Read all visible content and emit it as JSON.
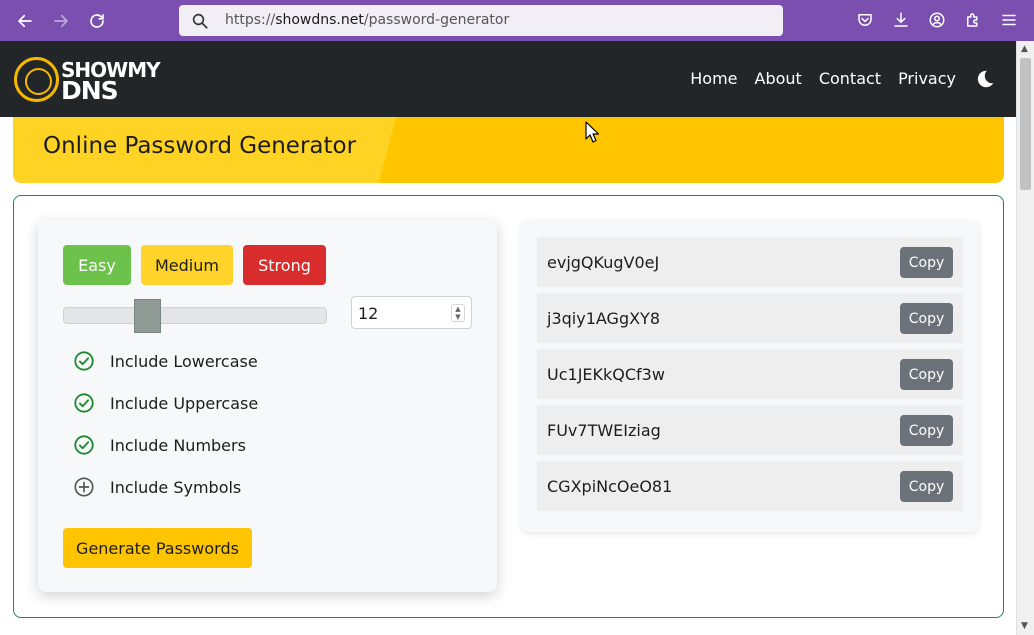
{
  "browser": {
    "url_prefix": "https://",
    "url_host": "showdns.net",
    "url_path": "/password-generator",
    "icons": [
      "back-icon",
      "forward-icon",
      "reload-icon",
      "search-icon",
      "pocket-icon",
      "download-icon",
      "account-icon",
      "extensions-icon",
      "menu-icon"
    ]
  },
  "header": {
    "logo_line1": "SHOWMY",
    "logo_line2": "DNS",
    "nav": [
      {
        "label": "Home"
      },
      {
        "label": "About"
      },
      {
        "label": "Contact"
      },
      {
        "label": "Privacy"
      }
    ],
    "theme_icon": "moon-icon"
  },
  "banner": {
    "title": "Online Password Generator"
  },
  "generator": {
    "difficulty": {
      "easy": "Easy",
      "medium": "Medium",
      "strong": "Strong"
    },
    "length": {
      "value": "12",
      "slider_fraction": 0.3
    },
    "options": [
      {
        "label": "Include Lowercase",
        "checked": true
      },
      {
        "label": "Include Uppercase",
        "checked": true
      },
      {
        "label": "Include Numbers",
        "checked": true
      },
      {
        "label": "Include Symbols",
        "checked": false
      }
    ],
    "generate_label": "Generate Passwords"
  },
  "passwords": {
    "copy_label": "Copy",
    "items": [
      "evjgQKugV0eJ",
      "j3qiy1AGgXY8",
      "Uc1JEKkQCf3w",
      "FUv7TWEIziag",
      "CGXpiNcOeO81"
    ]
  },
  "colors": {
    "browser_bar": "#7b4fb0",
    "header_bg": "#222629",
    "accent_yellow": "#ffc600",
    "check_green": "#1c8a2c",
    "easy": "#6cc24a",
    "medium": "#ffd32a",
    "strong": "#d92c2c"
  }
}
